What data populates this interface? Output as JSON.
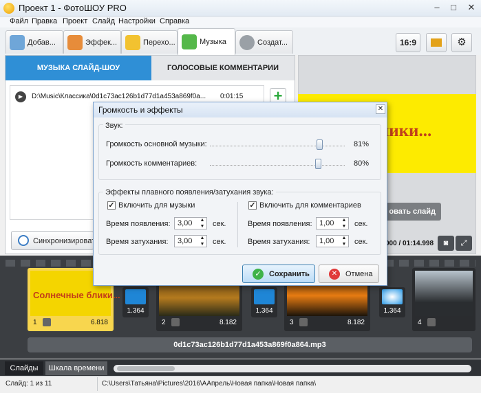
{
  "window": {
    "title": "Проект 1 - ФотоШОУ PRO",
    "minimize": "–",
    "maximize": "□",
    "close": "✕"
  },
  "menu": [
    "Файл",
    "Правка",
    "Проект",
    "Слайд",
    "Настройки",
    "Справка"
  ],
  "tabs": [
    {
      "label": "Добав..."
    },
    {
      "label": "Эффек..."
    },
    {
      "label": "Перехо..."
    },
    {
      "label": "Музыка"
    },
    {
      "label": "Создат..."
    }
  ],
  "toolbar_right": {
    "ratio": "16:9"
  },
  "music_panel": {
    "subtab_music": "МУЗЫКА СЛАЙД-ШОУ",
    "subtab_voice": "ГОЛОСОВЫЕ КОММЕНТАРИИ",
    "track": {
      "path": "D:\\Music\\Классика\\0d1c73ac126b1d77d1a453a869f0a...",
      "duration": "0:01:15"
    },
    "add_icon": "+",
    "sync_label": "Синхронизироват"
  },
  "preview": {
    "text": "е блики...",
    "edit_button": "овать слайд",
    "timecode": "000 / 01:14.998"
  },
  "dialog": {
    "title": "Громкость и эффекты",
    "close": "✕",
    "sound_group": "Звук:",
    "music_volume_label": "Громкость основной музыки:",
    "music_volume": "81%",
    "music_volume_level": 0.81,
    "comment_volume_label": "Громкость комментариев:",
    "comment_volume": "80%",
    "comment_volume_level": 0.8,
    "fade_group": "Эффекты плавного появления/затухания звука:",
    "music_check_label": "Включить для музыки",
    "comment_check_label": "Включить для комментариев",
    "fade_in_label": "Время появления:",
    "fade_out_label": "Время затухания:",
    "music_fade_in": "3,00",
    "music_fade_out": "3,00",
    "comment_fade_in": "1,00",
    "comment_fade_out": "1,00",
    "unit": "сек.",
    "save": "Сохранить",
    "cancel": "Отмена"
  },
  "slides": [
    {
      "num": "1",
      "dur": "6.818",
      "text": "Солнечные блики..."
    },
    {
      "num": "2",
      "dur": "8.182"
    },
    {
      "num": "3",
      "dur": "8.182"
    },
    {
      "num": "4",
      "dur": ""
    }
  ],
  "transitions": [
    "1.364",
    "1.364",
    "1.364"
  ],
  "music_track": "0d1c73ac126b1d77d1a453a869f0a864.mp3",
  "bottom_tabs": {
    "slides": "Слайды",
    "timeline": "Шкала времени"
  },
  "status": {
    "slide": "Слайд: 1 из 11",
    "path": "C:\\Users\\Татьяна\\Pictures\\2016\\ААпрель\\Новая папка\\Новая папка\\"
  }
}
